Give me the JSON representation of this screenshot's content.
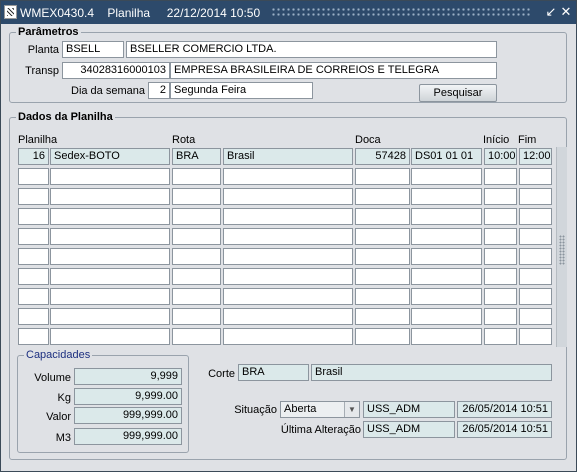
{
  "window": {
    "title": "WMEX0430.4    Planilha     22/12/2014 10:50"
  },
  "parametros": {
    "title": "Parâmetros",
    "planta_label": "Planta",
    "planta_code": "BSELL",
    "planta_name": "BSELLER COMERCIO LTDA.",
    "transp_label": "Transp",
    "transp_code": "34028316000103",
    "transp_name": "EMPRESA BRASILEIRA DE CORREIOS E TELEGRA",
    "dia_label": "Dia da semana",
    "dia_num": "2",
    "dia_name": "Segunda Feira",
    "search_label": "Pesquisar"
  },
  "dados": {
    "title": "Dados da Planilha",
    "columns": [
      "Planilha",
      "Rota",
      "Doca",
      "Início",
      "Fim"
    ],
    "rows": [
      {
        "planilha": "16",
        "desc": "Sedex-BOTO",
        "rota": "BRA",
        "rota_name": "Brasil",
        "doca": "57428",
        "doca_name": "DS01 01 01",
        "inicio": "10:00",
        "fim": "12:00"
      }
    ],
    "empty_rows": 9
  },
  "capacidades": {
    "title": "Capacidades",
    "volume_label": "Volume",
    "volume": "9,999",
    "kg_label": "Kg",
    "kg": "9,999.00",
    "valor_label": "Valor",
    "valor": "999,999.00",
    "m3_label": "M3",
    "m3": "999,999.00"
  },
  "corte": {
    "label": "Corte",
    "code": "BRA",
    "name": "Brasil"
  },
  "situacao": {
    "label": "Situação",
    "value": "Aberta",
    "user": "USS_ADM",
    "date": "26/05/2014 10:51",
    "ultima_label": "Última Alteração",
    "ultima_user": "USS_ADM",
    "ultima_date": "26/05/2014 10:51"
  }
}
